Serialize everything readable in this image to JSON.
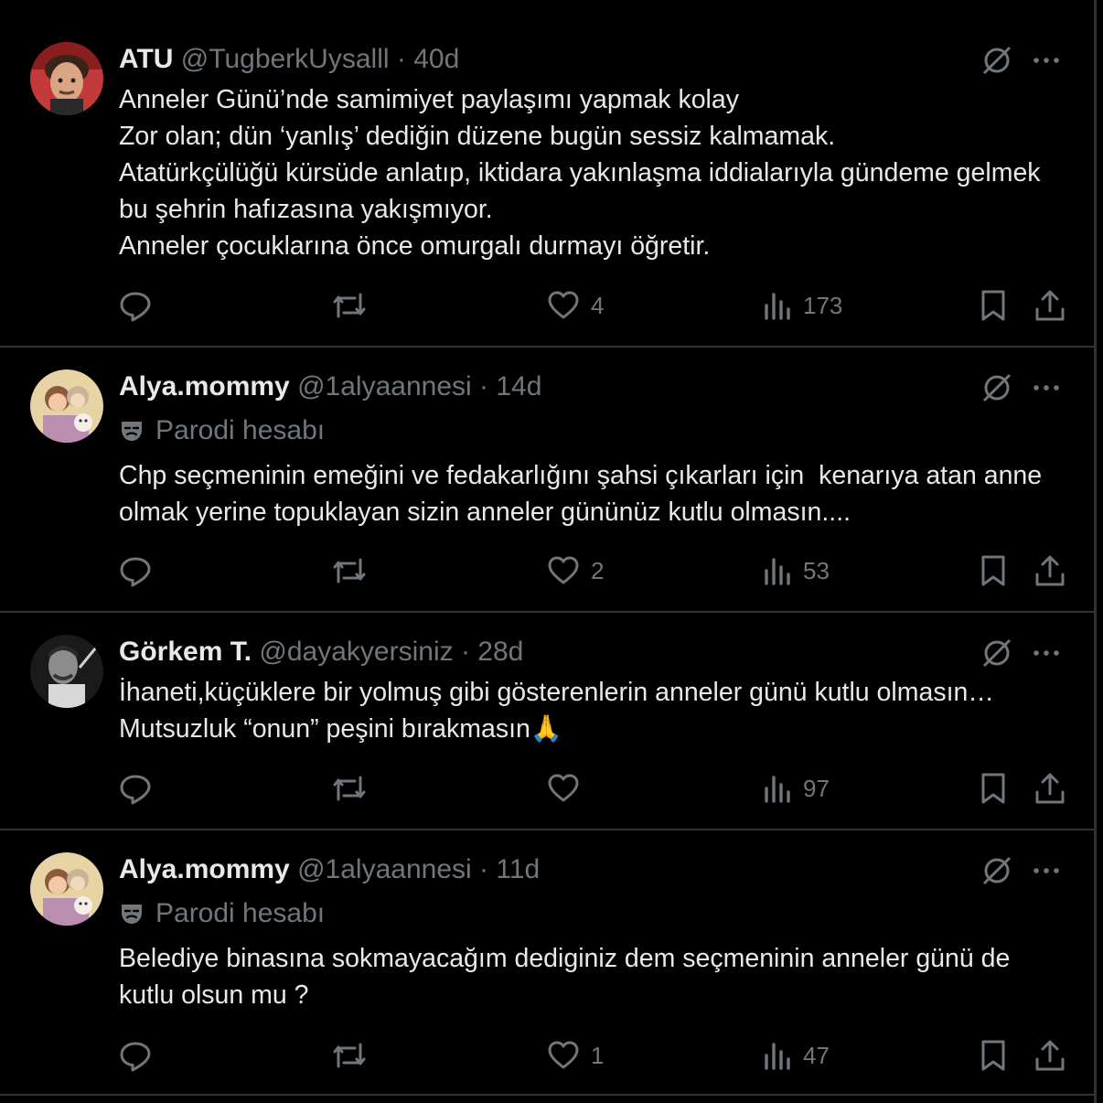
{
  "tweets": [
    {
      "name": "ATU",
      "handle": "@TugberkUysalll",
      "separator": "·",
      "time": "40d",
      "badge": "",
      "text": "Anneler Günü’nde samimiyet paylaşımı yapmak kolay\nZor olan; dün ‘yanlış’ dediğin düzene bugün sessiz kalmamak.\nAtatürkçülüğü kürsüde anlatıp, iktidara yakınlaşma iddialarıyla gündeme gelmek bu şehrin hafızasına yakışmıyor.\nAnneler çocuklarına önce omurgalı durmayı öğretir.",
      "likes": "4",
      "views": "173"
    },
    {
      "name": "Alya.mommy",
      "handle": "@1alyaannesi",
      "separator": "·",
      "time": "14d",
      "badge": "Parodi hesabı",
      "text": "Chp seçmeninin emeğini ve fedakarlığını şahsi çıkarları için  kenarıya atan anne olmak yerine topuklayan sizin anneler gününüz kutlu olmasın....",
      "likes": "2",
      "views": "53"
    },
    {
      "name": "Görkem T.",
      "handle": "@dayakyersiniz",
      "separator": "·",
      "time": "28d",
      "badge": "",
      "text": "İhaneti,küçüklere bir yolmuş gibi gösterenlerin anneler günü kutlu olmasın…\nMutsuzluk “onun” peşini bırakmasın🙏",
      "likes": "",
      "views": "97"
    },
    {
      "name": "Alya.mommy",
      "handle": "@1alyaannesi",
      "separator": "·",
      "time": "11d",
      "badge": "Parodi hesabı",
      "text": "Belediye binasına sokmayacağım dediginiz dem seçmeninin anneler günü de kutlu olsun mu ?",
      "likes": "1",
      "views": "47"
    }
  ],
  "icons": {
    "grok": "grok-icon",
    "more": "more-icon",
    "reply": "reply-icon",
    "retweet": "retweet-icon",
    "like": "like-icon",
    "views": "views-icon",
    "bookmark": "bookmark-icon",
    "share": "share-icon",
    "parody": "parody-mask-icon"
  },
  "colors": {
    "background": "#000000",
    "text": "#e7e9ea",
    "secondary": "#71767b",
    "border": "#2f3336"
  }
}
